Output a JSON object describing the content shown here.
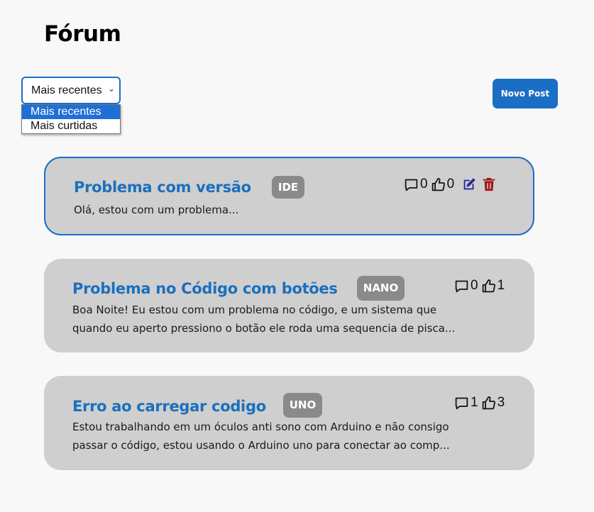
{
  "page": {
    "title": "Fórum"
  },
  "sort": {
    "selected": "Mais recentes",
    "options": [
      "Mais recentes",
      "Mais curtidas"
    ]
  },
  "new_post_label": "Novo Post",
  "colors": {
    "accent": "#1a6fc4",
    "card_bg": "#cfcfcf",
    "tag_bg": "#8a8a8a",
    "edit": "#2a2a9a",
    "delete": "#a01818"
  },
  "posts": [
    {
      "title": "Problema com versão",
      "tag": "IDE",
      "excerpt": [
        "Olá, estou com um problema..."
      ],
      "comments": "0",
      "likes": "0",
      "can_edit": true
    },
    {
      "title": "Problema no Código com botões",
      "tag": "NANO",
      "excerpt": [
        "Boa Noite! Eu estou com um problema no código, e um sistema que",
        "quando eu aperto pressiono o botão ele roda uma sequencia de pisca..."
      ],
      "comments": "0",
      "likes": "1",
      "can_edit": false
    },
    {
      "title": "Erro ao carregar codigo",
      "tag": "UNO",
      "excerpt": [
        "Estou trabalhando em um óculos anti sono com Arduino e não consigo",
        "passar o código, estou usando o Arduino uno para conectar ao comp..."
      ],
      "comments": "1",
      "likes": "3",
      "can_edit": false
    }
  ]
}
